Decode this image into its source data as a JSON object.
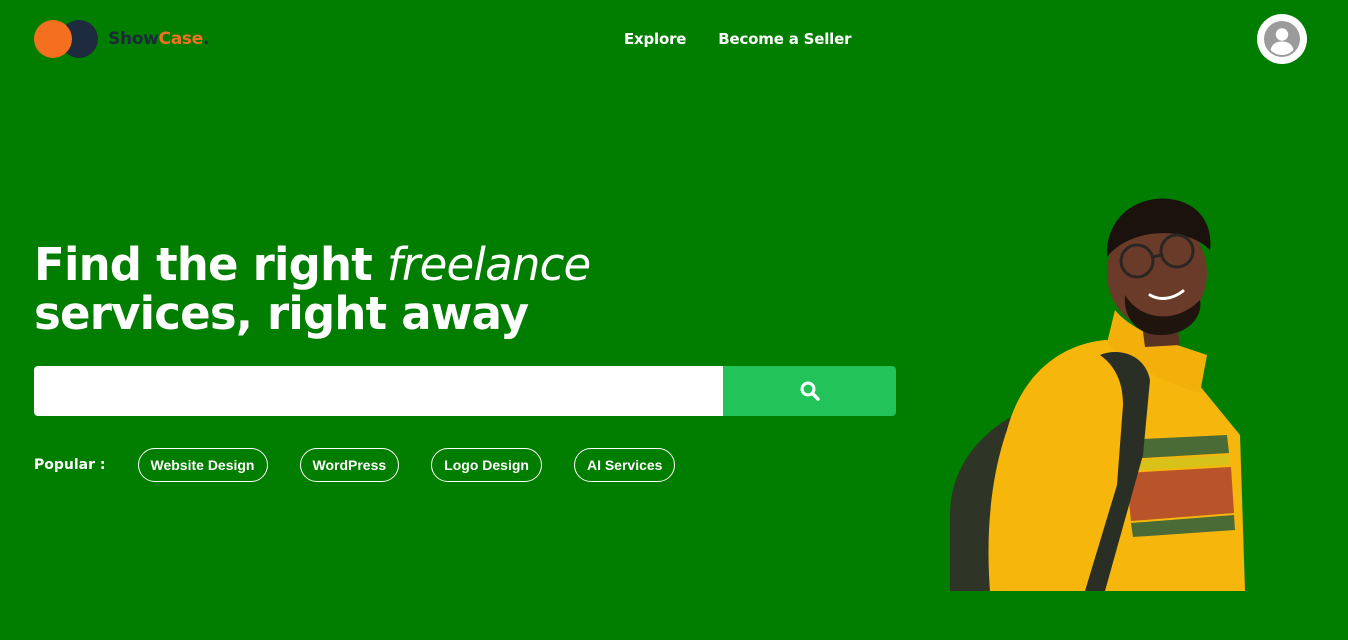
{
  "brand": {
    "name_part1": "Show",
    "name_part2": "Case",
    "name_part3": ".",
    "colors": {
      "orange": "#f4701e",
      "navy": "#1e2a3d",
      "background": "#017d00",
      "search_button": "#22c45a"
    }
  },
  "nav": {
    "items": [
      {
        "label": "Explore"
      },
      {
        "label": "Become a Seller"
      }
    ]
  },
  "header": {
    "avatar_icon": "user-circle-icon"
  },
  "hero": {
    "title_line1_start": "Find the right ",
    "title_line1_emphasis": "freelance",
    "title_line2": "services, right away"
  },
  "search": {
    "value": "",
    "placeholder": "",
    "button_icon": "search-icon"
  },
  "popular": {
    "label": "Popular :",
    "tags": [
      "Website Design",
      "WordPress",
      "Logo Design",
      "AI Services"
    ]
  },
  "hero_image": {
    "subject": "smiling young man in yellow hoodie with backpack and glasses"
  }
}
